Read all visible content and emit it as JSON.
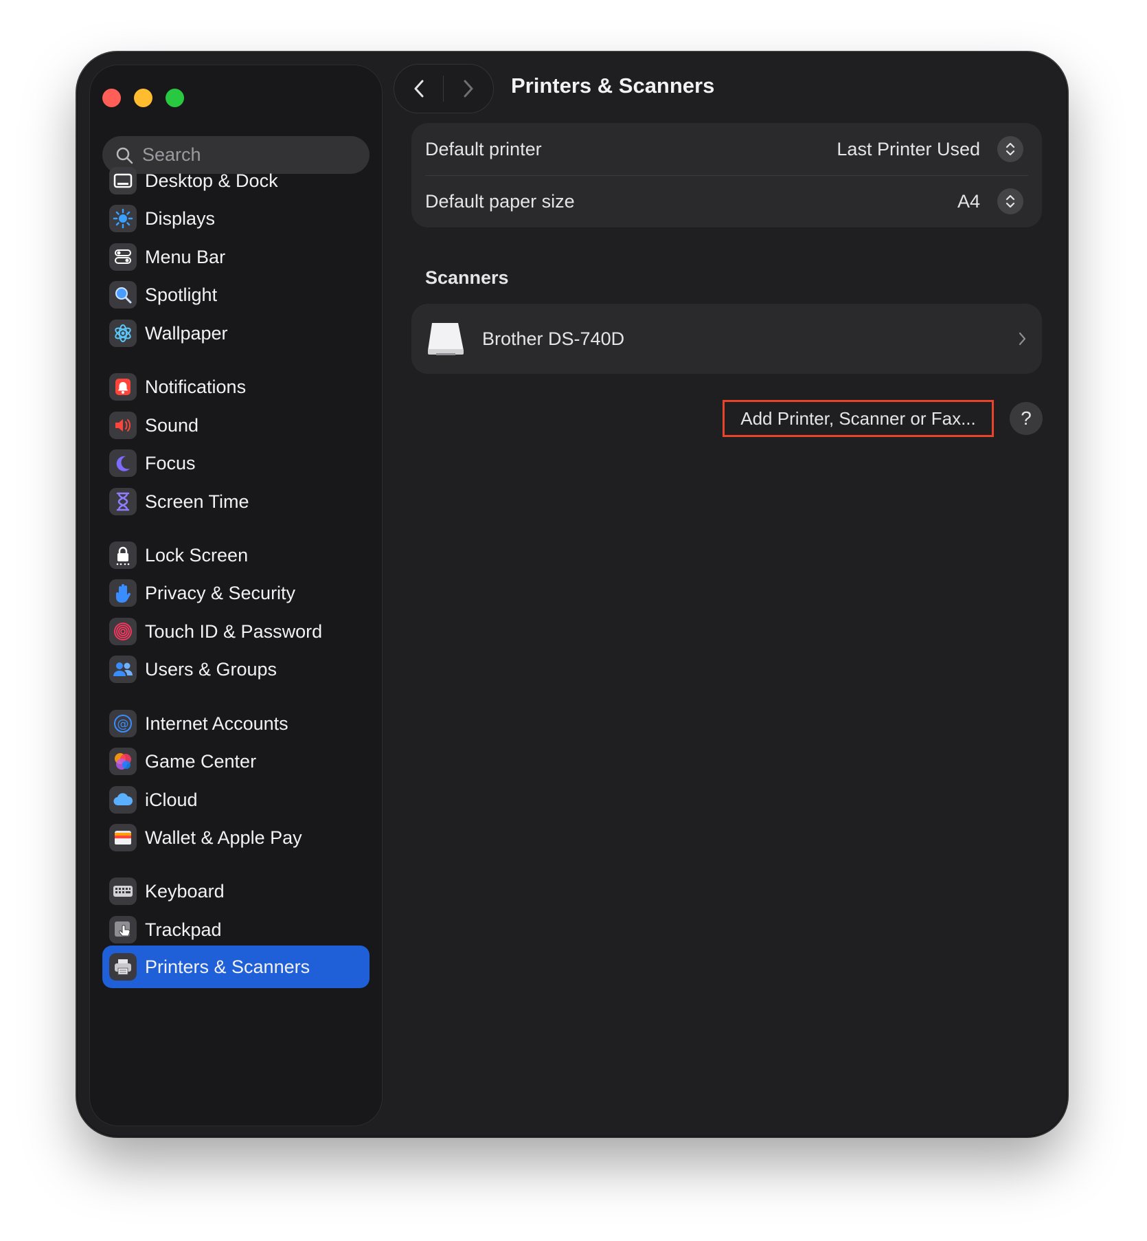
{
  "window": {
    "title": "Printers & Scanners"
  },
  "search": {
    "placeholder": "Search"
  },
  "sidebar": {
    "items": [
      {
        "label": "Desktop & Dock",
        "icon": "desktop-dock-icon"
      },
      {
        "label": "Displays",
        "icon": "displays-icon"
      },
      {
        "label": "Menu Bar",
        "icon": "menu-bar-icon"
      },
      {
        "label": "Spotlight",
        "icon": "spotlight-icon"
      },
      {
        "label": "Wallpaper",
        "icon": "wallpaper-icon"
      },
      {
        "label": "Notifications",
        "icon": "notifications-icon"
      },
      {
        "label": "Sound",
        "icon": "sound-icon"
      },
      {
        "label": "Focus",
        "icon": "focus-icon"
      },
      {
        "label": "Screen Time",
        "icon": "screen-time-icon"
      },
      {
        "label": "Lock Screen",
        "icon": "lock-screen-icon"
      },
      {
        "label": "Privacy & Security",
        "icon": "privacy-security-icon"
      },
      {
        "label": "Touch ID & Password",
        "icon": "touch-id-icon"
      },
      {
        "label": "Users & Groups",
        "icon": "users-groups-icon"
      },
      {
        "label": "Internet Accounts",
        "icon": "internet-accounts-icon"
      },
      {
        "label": "Game Center",
        "icon": "game-center-icon"
      },
      {
        "label": "iCloud",
        "icon": "icloud-icon"
      },
      {
        "label": "Wallet & Apple Pay",
        "icon": "wallet-icon"
      },
      {
        "label": "Keyboard",
        "icon": "keyboard-icon"
      },
      {
        "label": "Trackpad",
        "icon": "trackpad-icon"
      },
      {
        "label": "Printers & Scanners",
        "icon": "printer-icon",
        "selected": true
      }
    ]
  },
  "settings": {
    "default_printer_label": "Default printer",
    "default_printer_value": "Last Printer Used",
    "default_paper_label": "Default paper size",
    "default_paper_value": "A4"
  },
  "scanners": {
    "heading": "Scanners",
    "items": [
      {
        "name": "Brother DS-740D"
      }
    ]
  },
  "actions": {
    "add_label": "Add Printer, Scanner or Fax...",
    "help_label": "?"
  },
  "colors": {
    "accent": "#1f5fd8",
    "highlight_border": "#e8442c",
    "window_bg": "#1f1f21"
  }
}
